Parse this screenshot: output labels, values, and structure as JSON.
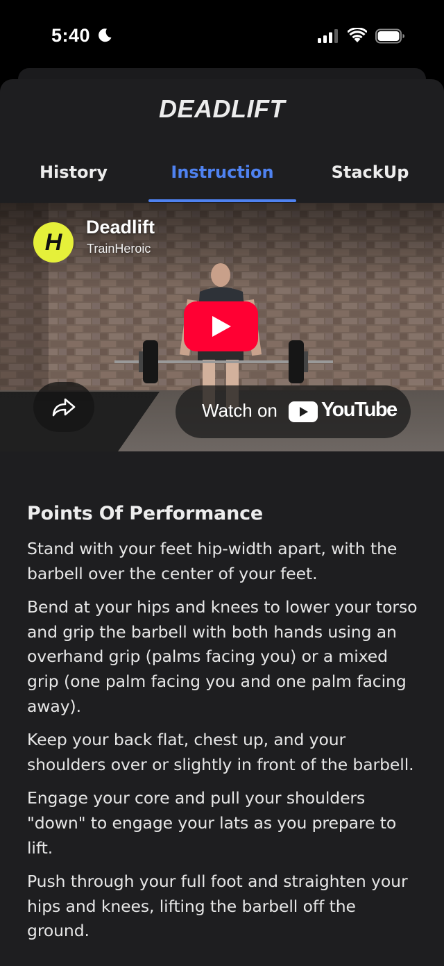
{
  "status_bar": {
    "time": "5:40"
  },
  "exercise": {
    "title": "DEADLIFT"
  },
  "tabs": [
    {
      "label": "History",
      "active": false
    },
    {
      "label": "Instruction",
      "active": true
    },
    {
      "label": "StackUp",
      "active": false
    }
  ],
  "video": {
    "title": "Deadlift",
    "channel": "TrainHeroic",
    "channel_logo_letter": "H",
    "watch_label": "Watch on",
    "platform": "YouTube"
  },
  "instructions": {
    "heading": "Points Of Performance",
    "steps": [
      "Stand with your feet hip-width apart, with the barbell over the center of your feet.",
      "Bend at your hips and knees to lower your torso and grip the barbell with both hands using an overhand grip (palms facing you) or a mixed grip (one palm facing you and one palm facing away).",
      "Keep your back flat, chest up, and your shoulders over or slightly in front of the barbell.",
      "Engage your core and pull your shoulders \"down\" to engage your lats as you prepare to lift.",
      "Push through your full foot and straighten your hips and knees, lifting the barbell off the ground."
    ]
  },
  "colors": {
    "accent": "#4f82f0",
    "sheet_background": "#1e1e20",
    "youtube_red": "#ff0033",
    "channel_logo": "#e5f03a"
  }
}
